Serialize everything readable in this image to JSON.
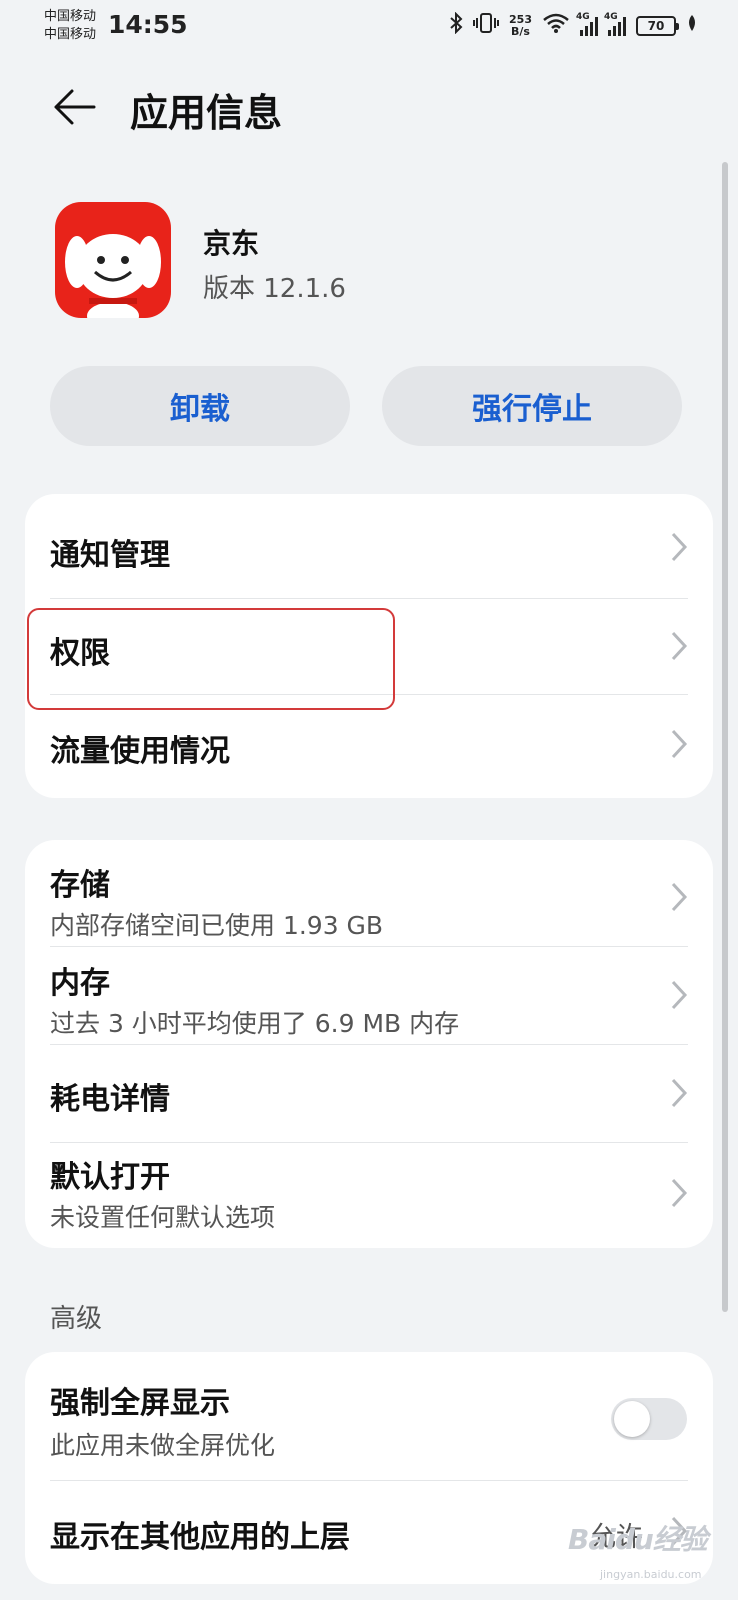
{
  "status_bar": {
    "carrier_1": "中国移动",
    "carrier_2": "中国移动",
    "time": "14:55",
    "net_speed_value": "253",
    "net_speed_unit": "B/s",
    "signal_tag": "4G",
    "battery": "70"
  },
  "header": {
    "title": "应用信息"
  },
  "app": {
    "name": "京东",
    "version": "版本 12.1.6",
    "icon_color": "#e8231a"
  },
  "buttons": {
    "uninstall": "卸载",
    "force_stop": "强行停止"
  },
  "group1": {
    "notification": "通知管理",
    "permissions": "权限",
    "data_usage": "流量使用情况"
  },
  "group2": {
    "storage_title": "存储",
    "storage_sub": "内部存储空间已使用 1.93 GB",
    "memory_title": "内存",
    "memory_sub": "过去 3 小时平均使用了 6.9 MB 内存",
    "battery_title": "耗电详情",
    "default_title": "默认打开",
    "default_sub": "未设置任何默认选项"
  },
  "advanced": {
    "section": "高级",
    "fullscreen_title": "强制全屏显示",
    "fullscreen_sub": "此应用未做全屏优化",
    "fullscreen_enabled": false,
    "overlay_title": "显示在其他应用的上层",
    "overlay_value": "允许"
  },
  "watermark": {
    "text": "Baidu经验",
    "sub": "jingyan.baidu.com"
  },
  "colors": {
    "accent": "#1a5fd0",
    "highlight": "#d33a3a",
    "background": "#f1f3f5"
  }
}
